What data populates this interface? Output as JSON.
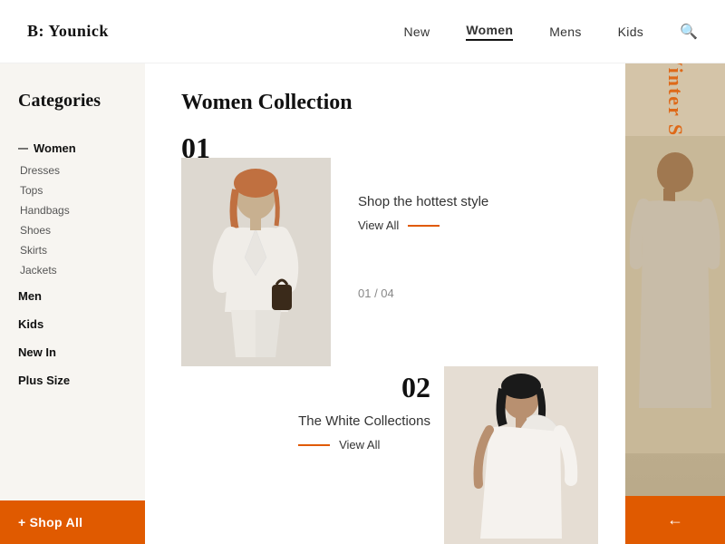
{
  "brand": {
    "name": "B: Younick"
  },
  "nav": {
    "items": [
      {
        "id": "new",
        "label": "New",
        "active": false
      },
      {
        "id": "women",
        "label": "Women",
        "active": true
      },
      {
        "id": "mens",
        "label": "Mens",
        "active": false
      },
      {
        "id": "kids",
        "label": "Kids",
        "active": false
      }
    ],
    "search_icon": "🔍"
  },
  "sidebar": {
    "title": "Categories",
    "active_category": "Women",
    "sub_items": [
      "Dresses",
      "Tops",
      "Handbags",
      "Shoes",
      "Skirts",
      "Jackets"
    ],
    "main_links": [
      "Men",
      "Kids",
      "New In",
      "Plus Size"
    ],
    "shop_all_label": "+ Shop All"
  },
  "content": {
    "collection_title": "Women Collection",
    "items": [
      {
        "number": "01",
        "tagline": "Shop the hottest style",
        "view_all_label": "View All",
        "pagination": "01 / 04"
      },
      {
        "number": "02",
        "title": "The White Collections",
        "view_all_label": "View All"
      }
    ]
  },
  "right_panel": {
    "rotated_text": "Winter Shades",
    "arrow_label": "←"
  },
  "colors": {
    "accent": "#e05a00",
    "sidebar_bg": "#f7f5f1",
    "right_panel_bg": "#d4c4a8"
  }
}
